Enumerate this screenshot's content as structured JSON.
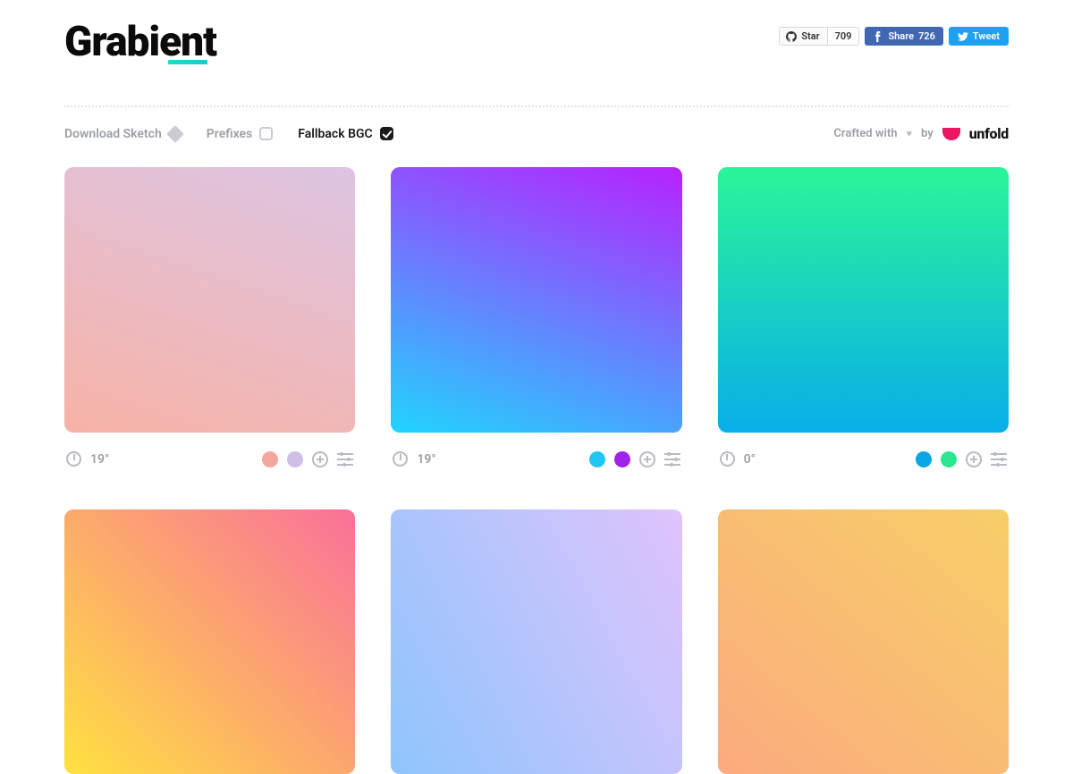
{
  "header": {
    "logo": "Grabient"
  },
  "social": {
    "github_label": "Star",
    "github_count": "709",
    "facebook_label": "Share",
    "facebook_count": "726",
    "twitter_label": "Tweet"
  },
  "toolbar": {
    "download_label": "Download Sketch",
    "prefixes_label": "Prefixes",
    "prefixes_checked": false,
    "fallback_label": "Fallback BGC",
    "fallback_checked": true,
    "crafted_prefix": "Crafted with",
    "crafted_by": "by",
    "brand": "unfold"
  },
  "gradients": [
    {
      "angle": "19°",
      "css": "linear-gradient(19deg, #f7b2a6 0%, #ddc5e2 100%)",
      "stops": [
        "#f2a89d",
        "#cdbfe6"
      ]
    },
    {
      "angle": "19°",
      "css": "linear-gradient(19deg, #21D4FD 0%, #B721FF 100%)",
      "stops": [
        "#21c6f3",
        "#a023e8"
      ]
    },
    {
      "angle": "0°",
      "css": "linear-gradient(0deg, #08AEEA 0%, #2AF598 100%)",
      "stops": [
        "#0aa7e5",
        "#2ce78f"
      ]
    },
    {
      "angle": "",
      "css": "linear-gradient(45deg, #FEE140 0%, #FA709A 100%)",
      "stops": []
    },
    {
      "angle": "",
      "css": "linear-gradient(62deg, #8EC5FC 0%, #E0C3FC 100%)",
      "stops": []
    },
    {
      "angle": "",
      "css": "linear-gradient(40deg, #FBAB7E 0%, #F7CE68 100%)",
      "stops": []
    }
  ]
}
